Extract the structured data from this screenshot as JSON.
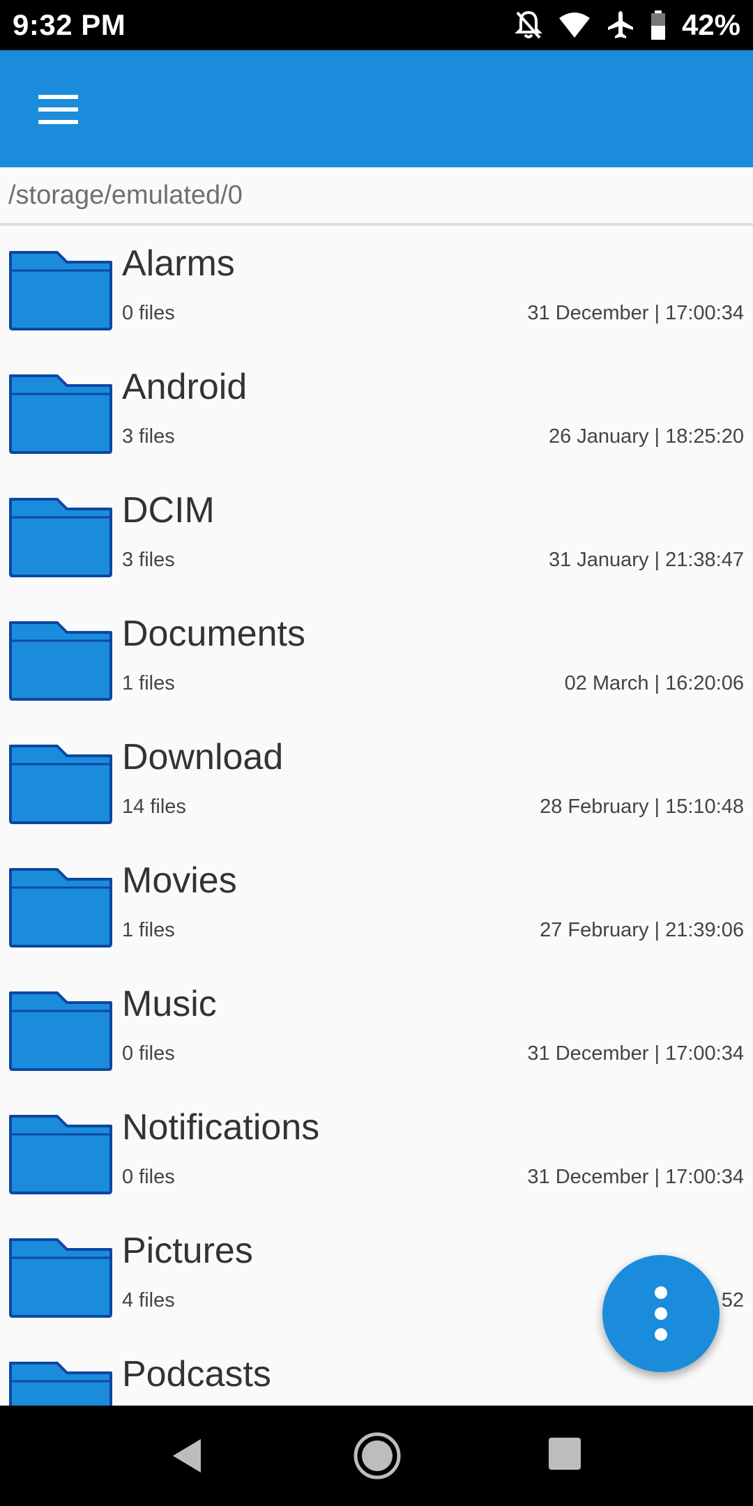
{
  "status_bar": {
    "time": "9:32 PM",
    "battery": "42%",
    "icons": [
      "notifications-off-icon",
      "wifi-icon",
      "airplane-icon",
      "battery-icon"
    ]
  },
  "app_bar": {
    "menu_icon": "hamburger-menu-icon",
    "color": "#1a8cdb"
  },
  "path": "/storage/emulated/0",
  "folders": [
    {
      "name": "Alarms",
      "count": "0 files",
      "date": "31 December | 17:00:34"
    },
    {
      "name": "Android",
      "count": "3 files",
      "date": "26 January | 18:25:20"
    },
    {
      "name": "DCIM",
      "count": "3 files",
      "date": "31 January | 21:38:47"
    },
    {
      "name": "Documents",
      "count": "1 files",
      "date": "02 March | 16:20:06"
    },
    {
      "name": "Download",
      "count": "14 files",
      "date": "28 February | 15:10:48"
    },
    {
      "name": "Movies",
      "count": "1 files",
      "date": "27 February | 21:39:06"
    },
    {
      "name": "Music",
      "count": "0 files",
      "date": "31 December | 17:00:34"
    },
    {
      "name": "Notifications",
      "count": "0 files",
      "date": "31 December | 17:00:34"
    },
    {
      "name": "Pictures",
      "count": "4 files",
      "date": "02 M…52"
    },
    {
      "name": "Podcasts",
      "count": "",
      "date": ""
    }
  ],
  "fab": {
    "icon": "more-vert-icon"
  },
  "nav_bar": {
    "icons": [
      "back-icon",
      "home-icon",
      "recents-icon"
    ]
  }
}
